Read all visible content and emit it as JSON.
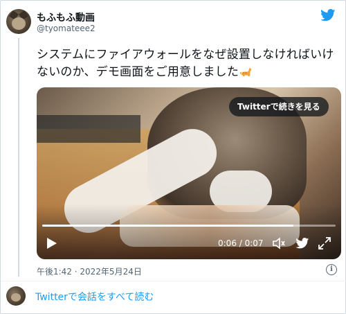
{
  "author": {
    "name": "もふもふ動画",
    "handle": "@tyomateee2"
  },
  "tweet": {
    "text": "システムにファイアウォールをなぜ設置しなければいけないのか、デモ画面をご用意しました",
    "emoji": "cat-emoji"
  },
  "video": {
    "watch_label": "Twitterで続きを見る",
    "time": "0:06 / 0:07",
    "progress": 0.857
  },
  "meta": {
    "timestamp": "午後1:42 · 2022年5月24日",
    "info_icon": "i"
  },
  "footer": {
    "read_all": "Twitterで会話をすべて読む"
  },
  "colors": {
    "accent": "#1d9bf0",
    "text": "#0f1419",
    "muted": "#536471",
    "border": "#cfd9de"
  }
}
